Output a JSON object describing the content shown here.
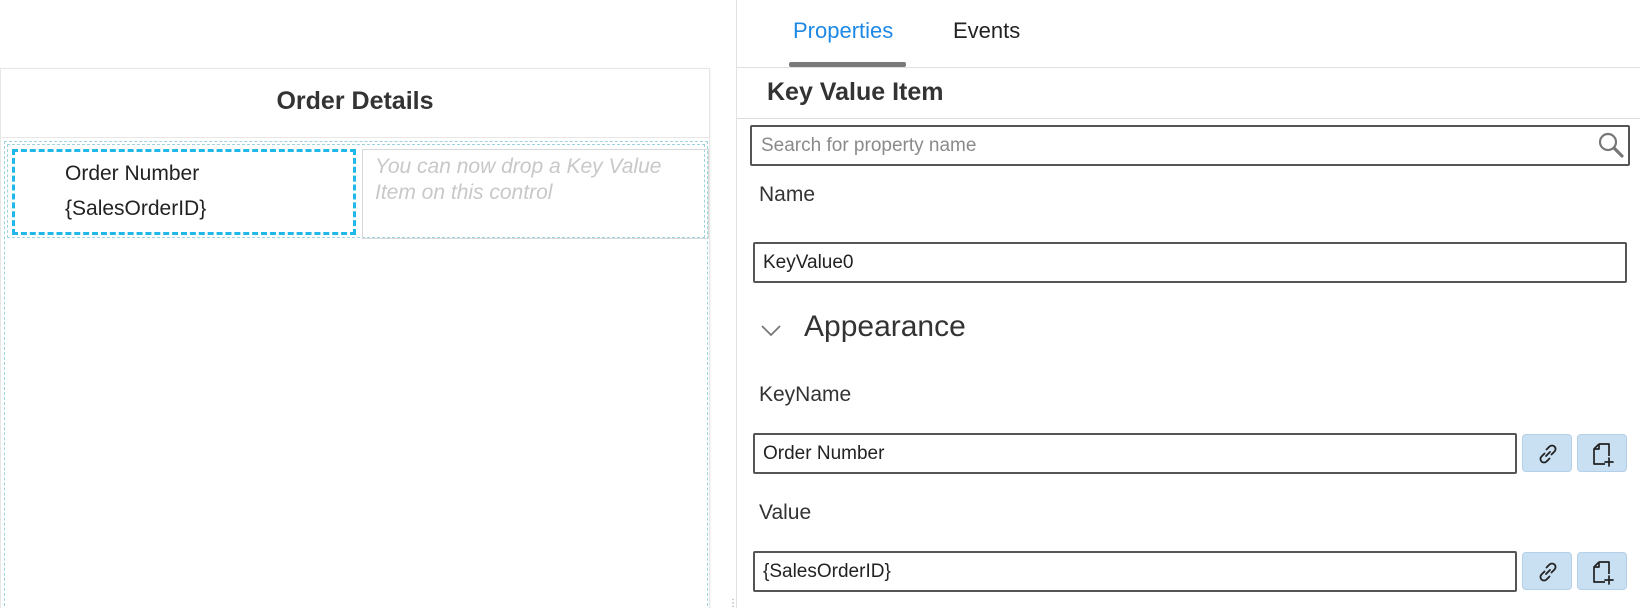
{
  "canvas": {
    "form_title": "Order Details",
    "key_value_item": {
      "key": "Order Number",
      "value": "{SalesOrderID}"
    },
    "drop_hint": "You can now drop a Key Value Item on this control"
  },
  "panel": {
    "tabs": [
      {
        "label": "Properties",
        "active": true
      },
      {
        "label": "Events",
        "active": false
      }
    ],
    "heading": "Key Value Item",
    "search": {
      "placeholder": "Search for property name",
      "value": ""
    },
    "name": {
      "label": "Name",
      "value": "KeyValue0"
    },
    "appearance": {
      "title": "Appearance",
      "expanded": true,
      "key_name": {
        "label": "KeyName",
        "value": "Order Number"
      },
      "value": {
        "label": "Value",
        "value": "{SalesOrderID}"
      }
    }
  },
  "icons": {
    "search": "magnifier-icon",
    "chevron": "chevron-down-icon",
    "bind": "link-icon",
    "new_expression": "page-add-icon"
  },
  "colors": {
    "accent": "#1e88e5",
    "selection": "#1fb8e8",
    "icon_button_bg": "#c9dff2"
  }
}
